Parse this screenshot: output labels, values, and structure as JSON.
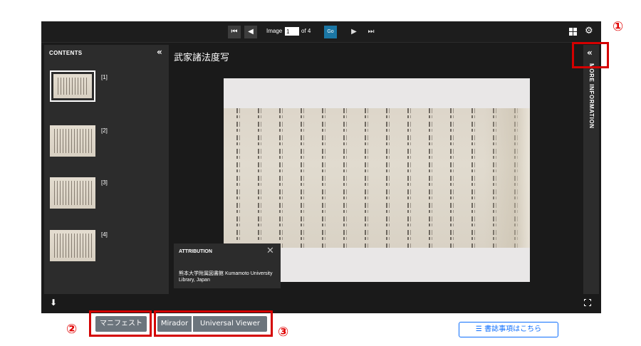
{
  "toolbar": {
    "first_icon": "first-page-icon",
    "prev_icon": "prev-page-icon",
    "image_label": "Image",
    "image_value": "1",
    "of_label": "of 4",
    "go_label": "Go",
    "next_icon": "next-page-icon",
    "last_icon": "last-page-icon",
    "grid_icon": "grid-view-icon",
    "settings_icon": "gear-icon"
  },
  "contents": {
    "title": "CONTENTS",
    "thumbnails": [
      {
        "label": "[1]",
        "selected": true
      },
      {
        "label": "[2]",
        "selected": false
      },
      {
        "label": "[3]",
        "selected": false
      },
      {
        "label": "[4]",
        "selected": false
      }
    ]
  },
  "main": {
    "title": "武家諸法度写"
  },
  "attribution": {
    "title": "ATTRIBUTION",
    "text": "熊本大学附属図書館 Kumamoto University Library, Japan"
  },
  "more_info": {
    "label": "MORE INFORMATION"
  },
  "annotations": {
    "marker_1": "①",
    "marker_2": "②",
    "marker_3": "③",
    "color": "#d40000"
  },
  "buttons": {
    "manifest": "マニフェスト",
    "mirador": "Mirador",
    "universal_viewer": "Universal Viewer",
    "biblio": "書誌事項はこちら"
  }
}
